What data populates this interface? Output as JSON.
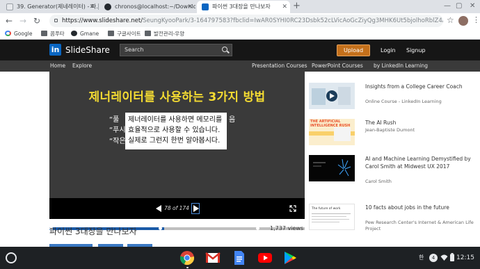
{
  "browser": {
    "tabs": [
      {
        "label": "39. Generator(제네레이터) - 파..."
      },
      {
        "label": "chronos@localhost:~/Downlo..."
      },
      {
        "label": "파이썬 3대장을 만나보자"
      }
    ],
    "url_main": "https://www.slideshare.net/",
    "url_rest": "SeungKyooPark/3-164797583?fbclid=IwAR0SYHI0RC23Dsbk52cLVicAoGcZiyQg3MHK6Ut5bjolhoRblZ4A5Q04fFU",
    "bookmarks": [
      {
        "label": "Google"
      },
      {
        "label": "콤푸타"
      },
      {
        "label": "Gmane"
      },
      {
        "label": "구글사이트"
      },
      {
        "label": "발전관리-우양"
      }
    ]
  },
  "slideshare": {
    "brand": "SlideShare",
    "search_placeholder": "Search",
    "upload": "Upload",
    "login": "Login",
    "signup": "Signup",
    "subnav_left": [
      "Home",
      "Explore"
    ],
    "subnav_right": [
      "Presentation Courses",
      "PowerPoint Courses",
      "by LinkedIn Learning"
    ]
  },
  "slide": {
    "title": "제너레이터를 사용하는 3가지 방법",
    "bullet_prefixes": [
      "“풀",
      "“푸시",
      "“작은"
    ],
    "trailing": "음",
    "overlay_lines": [
      "제너레이터를 사용하면 메모리를",
      "효율적으로 사용할 수 있습니다.",
      "실제로 그런지 한번 알아봅시다."
    ],
    "current_page": 78,
    "total_pages": 174,
    "page_label": "78 of 174"
  },
  "deck": {
    "title": "파이썬 3대장을 만나보자",
    "views": "1,737 views"
  },
  "related": [
    {
      "title": "Insights from a College Career Coach",
      "sub": "Online Course - LinkedIn Learning"
    },
    {
      "title": "The AI Rush",
      "sub": "Jean-Baptiste Dumont",
      "thumb_text": "THE ARTIFICIAL INTELLIGENCE RUSH"
    },
    {
      "title": "AI and Machine Learning Demystified by Carol Smith at Midwest UX 2017",
      "sub": "Carol Smith"
    },
    {
      "title": "10 facts about jobs in the future",
      "sub": "Pew Research Center's Internet & American Life Project",
      "thumb_text": "The future of work"
    }
  ],
  "shelf": {
    "ime": "한",
    "notification_count": "4",
    "time": "12:15"
  },
  "colors": {
    "slideshare_orange": "#c4701b",
    "slide_title_yellow": "#f5dc32",
    "progress_blue": "#1a5aa7",
    "linkedin_blue": "#0a66c2"
  }
}
